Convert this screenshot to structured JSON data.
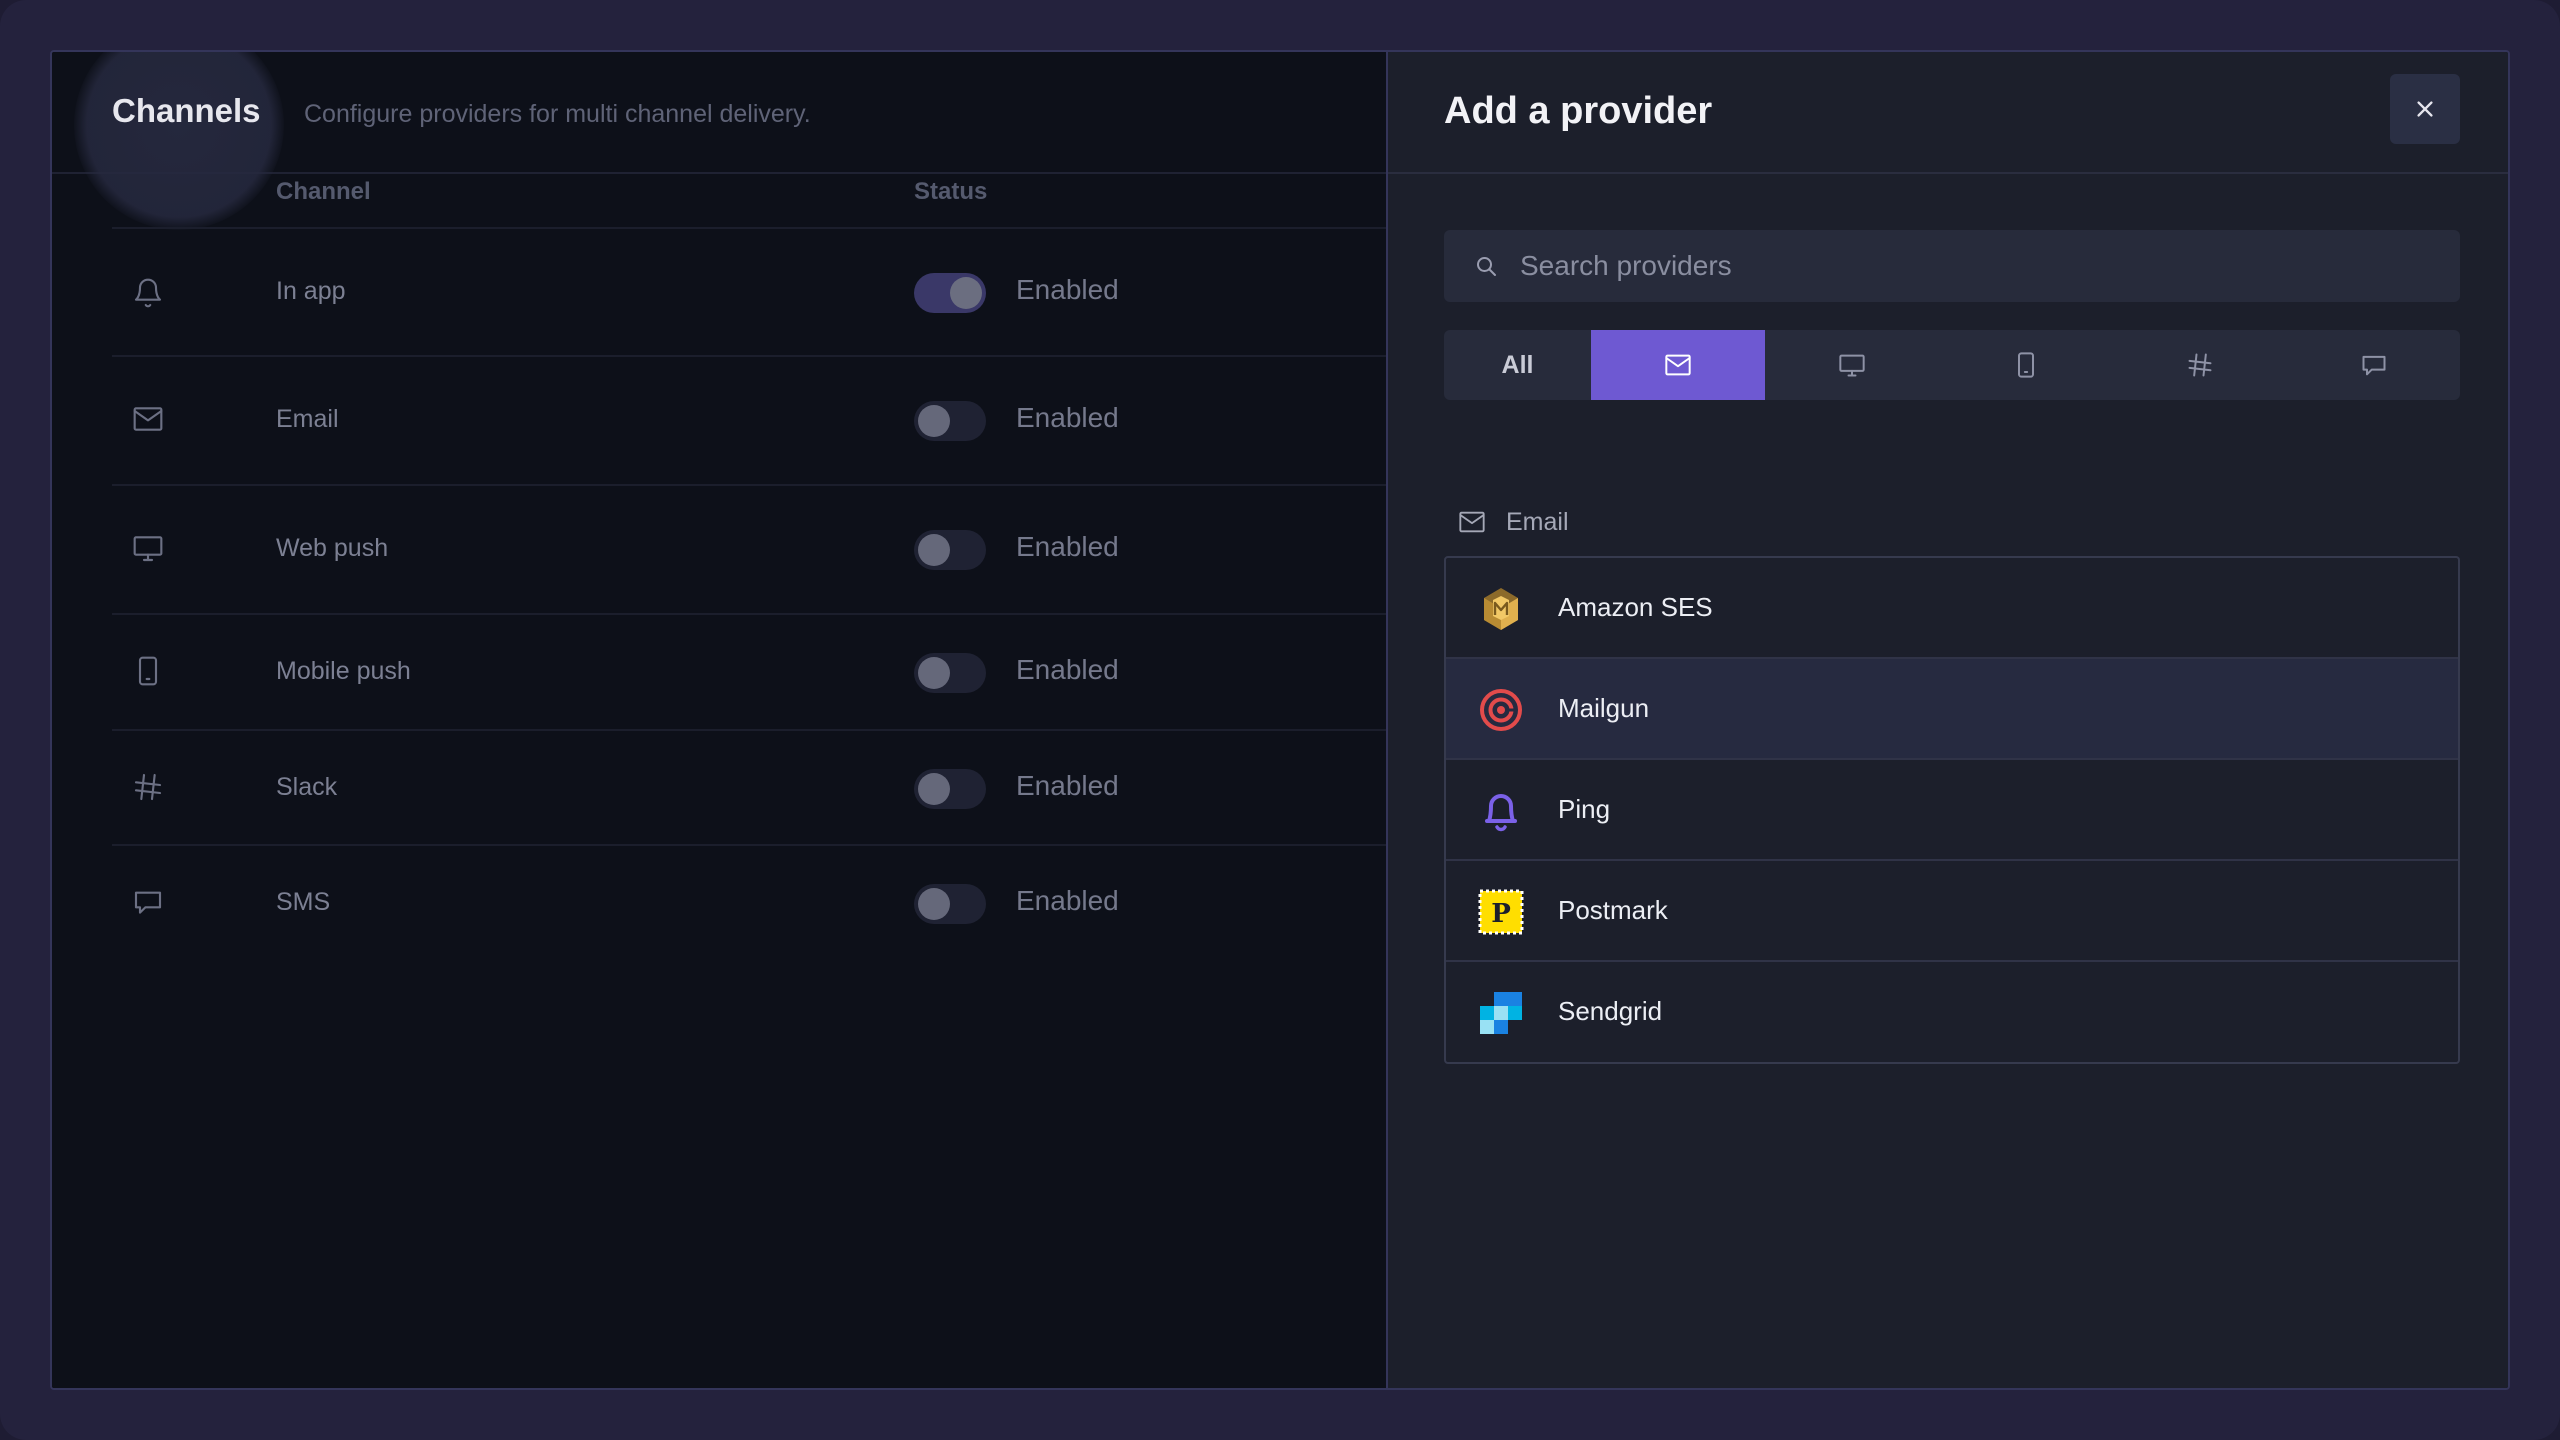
{
  "left": {
    "title": "Channels",
    "subtitle": "Configure providers for multi channel delivery.",
    "columns": {
      "channel": "Channel",
      "status": "Status"
    },
    "rows": [
      {
        "icon": "bell-icon",
        "name": "In app",
        "status": "Enabled",
        "on": true
      },
      {
        "icon": "mail-icon",
        "name": "Email",
        "status": "Enabled",
        "on": false
      },
      {
        "icon": "monitor-icon",
        "name": "Web push",
        "status": "Enabled",
        "on": false
      },
      {
        "icon": "smartphone-icon",
        "name": "Mobile push",
        "status": "Enabled",
        "on": false
      },
      {
        "icon": "slack-icon",
        "name": "Slack",
        "status": "Enabled",
        "on": false
      },
      {
        "icon": "message-icon",
        "name": "SMS",
        "status": "Enabled",
        "on": false
      }
    ]
  },
  "right": {
    "title": "Add a provider",
    "search_placeholder": "Search providers",
    "tabs": [
      {
        "label": "All",
        "active": false
      },
      {
        "icon": "mail-icon",
        "active": true
      },
      {
        "icon": "monitor-icon",
        "active": false
      },
      {
        "icon": "smartphone-icon",
        "active": false
      },
      {
        "icon": "slack-icon",
        "active": false
      },
      {
        "icon": "message-icon",
        "active": false
      }
    ],
    "section": "Email",
    "providers": [
      {
        "name": "Amazon SES",
        "logo": "amazon-ses-logo"
      },
      {
        "name": "Mailgun",
        "logo": "mailgun-logo",
        "hovered": true
      },
      {
        "name": "Ping",
        "logo": "ping-logo"
      },
      {
        "name": "Postmark",
        "logo": "postmark-logo"
      },
      {
        "name": "Sendgrid",
        "logo": "sendgrid-logo"
      }
    ]
  },
  "colors": {
    "accent": "#6e59d2",
    "toggle_on": "#3a3868",
    "panel_bg": "#1c1f2b"
  }
}
